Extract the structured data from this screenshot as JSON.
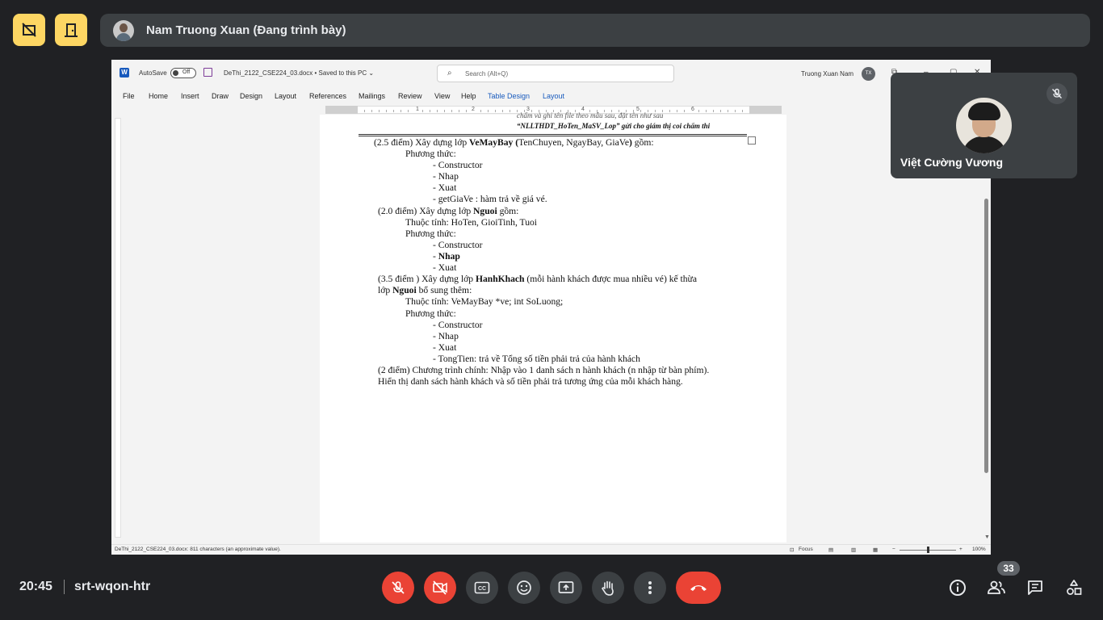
{
  "meet": {
    "presenter_name": "Nam Truong Xuan (Đang trình bày)",
    "participant_name": "Việt Cường Vương",
    "time": "20:45",
    "meeting_code": "srt-wqon-htr",
    "participant_count": "33"
  },
  "word": {
    "autosave_label": "AutoSave",
    "autosave_state": "Off",
    "doc_title": "DeThi_2122_CSE224_03.docx • Saved to this PC ⌄",
    "search_placeholder": "Search (Alt+Q)",
    "user_name": "Truong Xuan Nam",
    "user_initials": "TX",
    "tabs": [
      "File",
      "Home",
      "Insert",
      "Draw",
      "Design",
      "Layout",
      "References",
      "Mailings",
      "Review",
      "View",
      "Help",
      "Table Design",
      "Layout"
    ],
    "ruler_numbers": [
      "1",
      "2",
      "3",
      "4",
      "5",
      "6"
    ],
    "status_text": "DeThi_2122_CSE224_03.docx: 811 characters (an approximate value).",
    "focus_label": "Focus",
    "zoom_value": "100%",
    "zoom_fraction": 1.0
  },
  "document": {
    "header_cut": "chấm và ghi tên file theo mẫu sau, đặt tên như sau",
    "header_italic": "“NLLTHDT_HoTen_MaSV_Lop” gửi cho giám thị coi chấm thi",
    "q1": {
      "pre": "(2.5 điểm) Xây dựng lớp ",
      "cls": "VeMayBay",
      "open": " (",
      "params": "TenChuyen, NgayBay, GiaVe",
      "close": ")",
      "post": " gồm:"
    },
    "q1_methods": "Phương thức:",
    "q1_items": [
      "- Constructor",
      "- Nhap",
      "- Xuat",
      "- getGiaVe : hàm trả về giá vé."
    ],
    "q2": {
      "pre": "(2.0 điểm) Xây dựng lớp ",
      "cls": "Nguoi",
      "post": " gồm:"
    },
    "q2_attrs": "Thuộc tính:    HoTen, GioiTinh, Tuoi",
    "q2_methods": "Phương thức:",
    "q2_items": [
      "- Constructor",
      "- ",
      "Nhap",
      "- Xuat"
    ],
    "q3": {
      "pre": "(3.5 điểm ) Xây dựng lớp ",
      "cls": "HanhKhach",
      "post": " (mỗi hành khách được mua nhiều vé) kế thừa"
    },
    "q3_line2": {
      "pre": "lớp ",
      "cls": "Nguoi",
      "post": " bổ sung thêm:"
    },
    "q3_attrs": "Thuộc tính:    VeMayBay *ve;        int SoLuong;",
    "q3_methods": "Phương thức:",
    "q3_items": [
      "- Constructor",
      "- Nhap",
      "- Xuat",
      "- TongTien: trả về Tổng số tiền phải trả của hành khách"
    ],
    "q4_line1": "(2 điểm) Chương trình chính: Nhập vào 1 danh sách n hành khách (n nhập từ bàn phím).",
    "q4_line2": "Hiển thị danh sách hành khách và số tiền phải trả tương ứng của mỗi khách hàng."
  }
}
